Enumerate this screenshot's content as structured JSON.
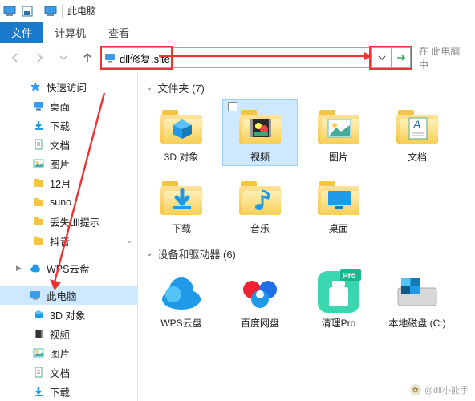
{
  "titlebar": {
    "title": "此电脑"
  },
  "ribbon": {
    "file": "文件",
    "computer": "计算机",
    "view": "查看"
  },
  "address": {
    "value": "dll修复.site",
    "search_hint": "在 此电脑 中"
  },
  "sidebar": {
    "quick": "快速访问",
    "quick_items": [
      {
        "label": "桌面",
        "icon": "desktop"
      },
      {
        "label": "下载",
        "icon": "download"
      },
      {
        "label": "文档",
        "icon": "document"
      },
      {
        "label": "图片",
        "icon": "picture"
      },
      {
        "label": "12月",
        "icon": "folder"
      },
      {
        "label": "suno",
        "icon": "folder"
      },
      {
        "label": "丢失dll提示",
        "icon": "folder"
      },
      {
        "label": "抖音",
        "icon": "folder"
      }
    ],
    "wps": "WPS云盘",
    "thispc": "此电脑",
    "pc_items": [
      {
        "label": "3D 对象",
        "icon": "3d"
      },
      {
        "label": "视频",
        "icon": "video"
      },
      {
        "label": "图片",
        "icon": "picture"
      },
      {
        "label": "文档",
        "icon": "document"
      },
      {
        "label": "下载",
        "icon": "download"
      }
    ]
  },
  "content": {
    "group_folders": "文件夹 (7)",
    "folders": [
      {
        "label": "3D 对象",
        "kind": "3d"
      },
      {
        "label": "视频",
        "kind": "video",
        "selected": true
      },
      {
        "label": "图片",
        "kind": "picture"
      },
      {
        "label": "文档",
        "kind": "document"
      },
      {
        "label": "下载",
        "kind": "download"
      },
      {
        "label": "音乐",
        "kind": "music"
      },
      {
        "label": "桌面",
        "kind": "desktop"
      }
    ],
    "group_drives": "设备和驱动器 (6)",
    "drives": [
      {
        "label": "WPS云盘",
        "kind": "wps"
      },
      {
        "label": "百度网盘",
        "kind": "baidu"
      },
      {
        "label": "清理Pro",
        "kind": "cleaner",
        "badge": "Pro"
      },
      {
        "label": "本地磁盘 (C:)",
        "kind": "disk"
      }
    ]
  },
  "watermark": "@dll小能手",
  "colors": {
    "accent": "#1979ca",
    "selection": "#cde8ff",
    "highlight": "#e33"
  }
}
